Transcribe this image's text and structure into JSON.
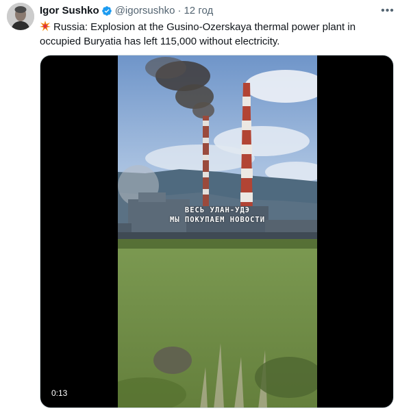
{
  "tweet": {
    "author": {
      "display_name": "Igor Sushko",
      "handle": "@igorsushko",
      "verified": true
    },
    "separator": "·",
    "time": "12 год",
    "more_icon": "ellipsis-icon",
    "emoji": "collision-icon",
    "text": "Russia: Explosion at the Gusino-Ozerskaya thermal power plant in occupied Buryatia has left 115,000 without electricity.",
    "media": {
      "type": "video",
      "duration": "0:13",
      "overlay_line1": "ВЕСЬ УЛАН-УДЭ",
      "overlay_line2": "МЫ ПОКУПАЕМ НОВОСТИ"
    },
    "colors": {
      "verified_badge": "#1d9bf0",
      "secondary_text": "#536471",
      "primary_text": "#0f1419"
    }
  }
}
